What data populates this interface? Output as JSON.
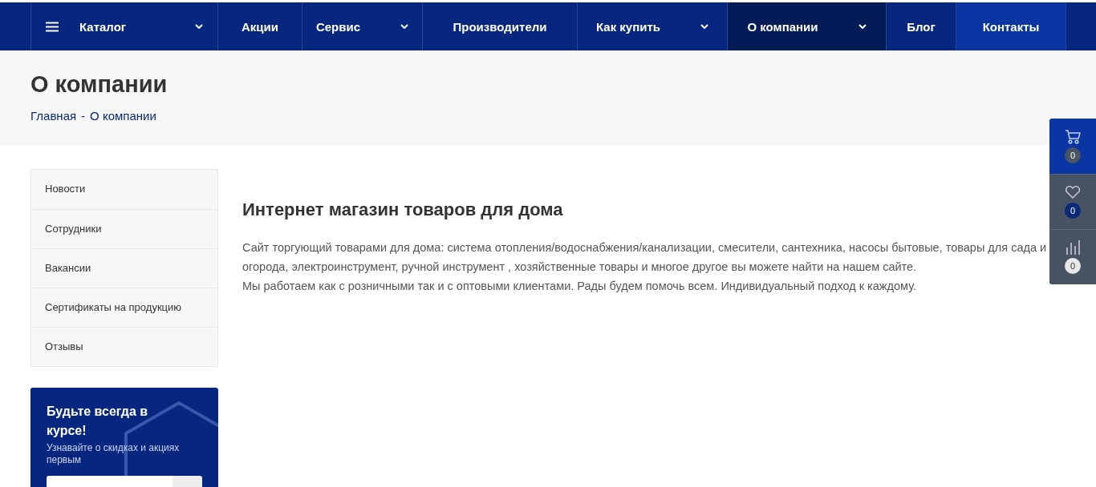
{
  "nav": {
    "items": [
      {
        "label": "Каталог",
        "kind": "catalog",
        "dropdown": true,
        "selected": false
      },
      {
        "label": "Акции",
        "kind": "link",
        "dropdown": false,
        "selected": false
      },
      {
        "label": "Сервис",
        "kind": "link",
        "dropdown": true,
        "selected": false
      },
      {
        "label": "Производители",
        "kind": "link",
        "dropdown": false,
        "selected": false
      },
      {
        "label": "Как купить",
        "kind": "link",
        "dropdown": true,
        "selected": false
      },
      {
        "label": "О компании",
        "kind": "link",
        "dropdown": true,
        "selected": true
      },
      {
        "label": "Блог",
        "kind": "link",
        "dropdown": false,
        "selected": false
      },
      {
        "label": "Контакты",
        "kind": "accent",
        "dropdown": false,
        "selected": false
      }
    ]
  },
  "header": {
    "title": "О компании",
    "breadcrumbs": [
      "Главная",
      "-",
      "О компании"
    ]
  },
  "sidebar": {
    "items": [
      {
        "label": "Новости",
        "selected": false
      },
      {
        "label": "Сотрудники",
        "selected": false
      },
      {
        "label": "Вакансии",
        "selected": false
      },
      {
        "label": "Сертификаты на продукцию",
        "selected": false
      },
      {
        "label": "Отзывы",
        "selected": false
      }
    ]
  },
  "subscribe": {
    "title": "Будьте всегда в курсе!",
    "text": "Узнавайте о скидках и акциях первым"
  },
  "content": {
    "heading": "Интернет магазин товаров для дома",
    "paragraphs": [
      "Сайт торгующий товарами для дома: система отопления/водоснабжения/канализации, смесители, сантехника, насосы бытовые, товары для сада и огорода, электроинструмент, ручной инструмент , хозяйственные товары и многое другое вы можете найти на нашем сайте.",
      "Мы работаем как с розничными так и с оптовыми клиентами. Рады будем помочь всем. Индивидуальный подход к каждому."
    ]
  },
  "side_panel": [
    {
      "kind": "cart",
      "count": "0",
      "color": "#4a5563",
      "selected": true
    },
    {
      "kind": "favorites",
      "count": "0",
      "color": "#0a2a78",
      "selected": false
    },
    {
      "kind": "compare",
      "count": "0",
      "color": "#e8e8e8",
      "selected": false
    }
  ]
}
